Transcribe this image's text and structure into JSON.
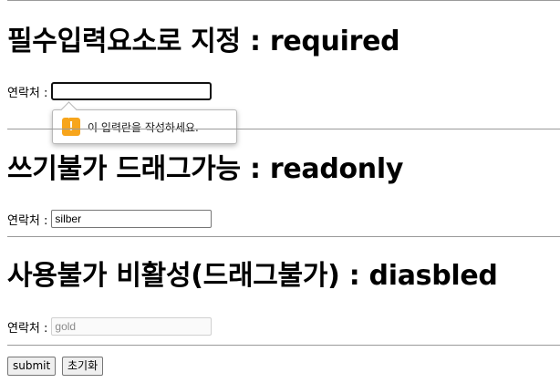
{
  "sections": [
    {
      "title": "필수입력요소로 지정 : required",
      "label": "연락처 :",
      "value": "",
      "state": "required-focused"
    },
    {
      "title": "쓰기불가 드래그가능 : readonly",
      "label": "연락처 :",
      "value": "silber",
      "state": "readonly"
    },
    {
      "title": "사용불가 비활성(드래그불가) : diasbled",
      "label": "연락처 :",
      "value": "gold",
      "state": "disabled"
    }
  ],
  "validation_tooltip": {
    "icon": "warning-icon",
    "icon_glyph": "!",
    "icon_color": "#f7a51c",
    "message": "이 입력란을 작성하세요."
  },
  "buttons": {
    "submit_label": "submit",
    "reset_label": "초기화"
  }
}
